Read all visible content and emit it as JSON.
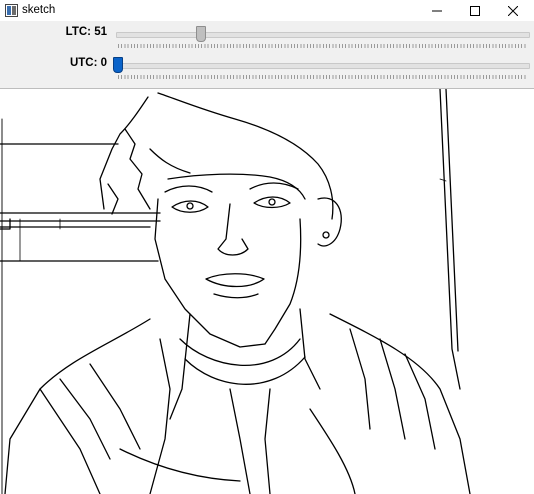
{
  "window": {
    "title": "sketch"
  },
  "titlebar_buttons": {
    "minimize_icon": "minimize-icon",
    "maximize_icon": "maximize-icon",
    "close_icon": "close-icon"
  },
  "trackbars": {
    "ltc": {
      "label": "LTC: 51",
      "value": 51
    },
    "utc": {
      "label": "UTC: 0",
      "value": 0
    }
  },
  "colors": {
    "thumb_gray": "#bfbfbf",
    "thumb_blue": "#0a63c9",
    "controls_bg": "#f0f0f0"
  }
}
